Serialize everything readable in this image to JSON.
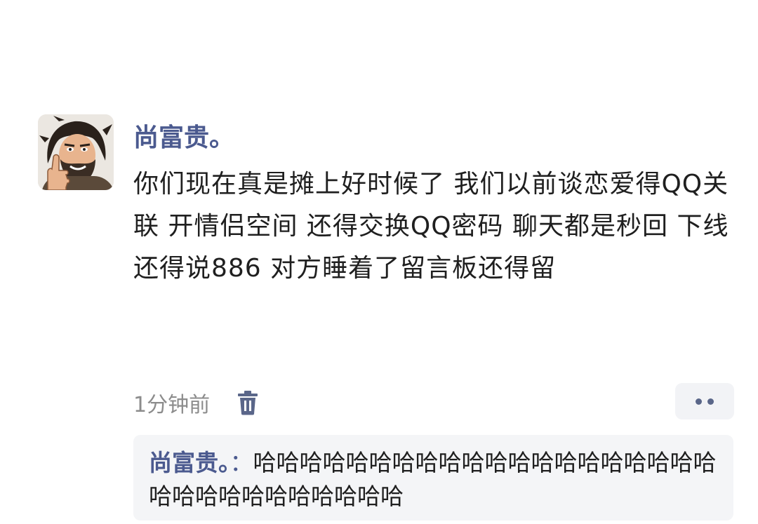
{
  "comment": {
    "avatar_icon": "bearded-man-thumbs-up-avatar",
    "username": "尚富贵。",
    "text": "你们现在真是摊上好时候了 我们以前谈恋爱得QQ关联 开情侣空间 还得交换QQ密码 聊天都是秒回 下线还得说886 对方睡着了留言板还得留",
    "timestamp": "1分钟前",
    "delete_icon": "trash-icon",
    "more_icon": "more-dots-icon"
  },
  "reply": {
    "author": "尚富贵。",
    "separator": "：",
    "text": "哈哈哈哈哈哈哈哈哈哈哈哈哈哈哈哈哈哈哈哈哈哈哈哈哈哈哈哈哈哈哈"
  },
  "colors": {
    "username": "#4b5a8f",
    "text": "#1f1f1f",
    "muted": "#8c8c8c",
    "reply_bg": "#f4f5f7",
    "more_bg": "#f2f3f6"
  }
}
